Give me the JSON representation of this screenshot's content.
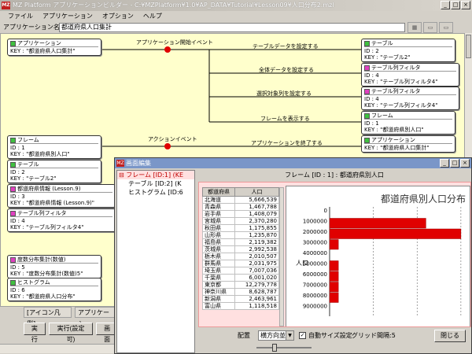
{
  "window": {
    "title": "MZ Platform アプリケーションビルダー - C:¥MZPlatform¥1.0¥AP_DATA¥Tutorial¥Lesson09¥人口分布2.mzl",
    "icon": "MZ",
    "min": "_",
    "max": "□",
    "close": "×"
  },
  "menu": [
    "ファイル",
    "アプリケーション",
    "オプション",
    "ヘルプ"
  ],
  "app_name": {
    "label": "アプリケーション名称",
    "value": "都道府県人口集計"
  },
  "canvas": {
    "events": {
      "app_start": "アプリケーション開始イベント",
      "action": "アクションイベント"
    },
    "conn_labels": [
      "テーブルデータを設定する",
      "全体データを設定する",
      "選択対象列を設定する",
      "フレームを表示する",
      "アプリケーションを終了する"
    ],
    "left_nodes": [
      {
        "title": "アプリケーション",
        "l1": "",
        "l2": "KEY : \"都道府県人口集計\"",
        "color": "green"
      },
      {
        "title": "フレーム",
        "l1": "ID : 1",
        "l2": "KEY : \"都道府県別人口\"",
        "color": "green"
      },
      {
        "title": "テーブル",
        "l1": "ID : 2",
        "l2": "KEY : \"テーブル2\"",
        "color": "green"
      },
      {
        "title": "都道府県情報 (Lesson.9)",
        "l1": "ID : 3",
        "l2": "KEY : \"都道府県情報 (Lesson.9)\"",
        "color": "pink"
      },
      {
        "title": "テーブル列フィルタ",
        "l1": "ID : 4",
        "l2": "KEY : \"テーブル列フィルタ4\"",
        "color": "pink"
      },
      {
        "title": "度数分布集計(数値)",
        "l1": "ID : 5",
        "l2": "KEY : \"度数分布集計(数値)5\"",
        "color": "pink"
      },
      {
        "title": "ヒストグラム",
        "l1": "ID : 6",
        "l2": "KEY : \"都道府県人口分布\"",
        "color": "green"
      }
    ],
    "right_nodes": [
      {
        "title": "テーブル",
        "l1": "ID : 2",
        "l2": "KEY : \"テーブル2\"",
        "color": "green"
      },
      {
        "title": "テーブル列フィルタ",
        "l1": "ID : 4",
        "l2": "KEY : \"テーブル列フィルタ4\"",
        "color": "pink"
      },
      {
        "title": "テーブル列フィルタ",
        "l1": "ID : 4",
        "l2": "KEY : \"テーブル列フィルタ4\"",
        "color": "pink"
      },
      {
        "title": "フレーム",
        "l1": "ID : 1",
        "l2": "KEY : \"都道府県別人口\"",
        "color": "green"
      },
      {
        "title": "アプリケーション",
        "l1": "",
        "l2": "KEY : \"都道府県人口集計\"",
        "color": "green"
      }
    ]
  },
  "bottom_tabs": [
    "[アイコン凡例]",
    "アプリケーシ"
  ],
  "bottom_buttons": [
    "実行",
    "実行(設定可)",
    "画面"
  ],
  "edit_window": {
    "title": "画面編集",
    "tree": {
      "root": "フレーム [ID:1] (KE",
      "children": [
        "テーブル [ID:2] (K",
        "ヒストグラム [ID:6"
      ]
    },
    "pane_title": "フレーム [ID : 1] : 都道府県別人口",
    "table": {
      "headers": [
        "都道府県",
        "人口"
      ],
      "rows": [
        [
          "北海道",
          "5,666,539"
        ],
        [
          "青森県",
          "1,467,788"
        ],
        [
          "岩手県",
          "1,408,079"
        ],
        [
          "宮城県",
          "2,370,280"
        ],
        [
          "秋田県",
          "1,175,855"
        ],
        [
          "山形県",
          "1,235,870"
        ],
        [
          "福島県",
          "2,119,382"
        ],
        [
          "茨城県",
          "2,992,538"
        ],
        [
          "栃木県",
          "2,010,507"
        ],
        [
          "群馬県",
          "2,031,975"
        ],
        [
          "埼玉県",
          "7,007,036"
        ],
        [
          "千葉県",
          "6,001,020"
        ],
        [
          "東京都",
          "12,279,778"
        ],
        [
          "神奈川県",
          "8,628,787"
        ],
        [
          "新潟県",
          "2,463,961"
        ],
        [
          "富山県",
          "1,118,518"
        ]
      ]
    },
    "layout_label": "配置",
    "layout_value": "横方向並列",
    "autosize_check": "✓",
    "autosize_label": "自動サイズ設定",
    "grid_label": "グリッド間隔:5",
    "close_button": "閉じる"
  },
  "chart_data": {
    "type": "bar",
    "title": "都道府県別人口分布",
    "ylabel": "人口",
    "categories": [
      0,
      1000000,
      2000000,
      3000000,
      4000000,
      5000000,
      6000000,
      7000000,
      8000000,
      9000000
    ],
    "values": [
      0,
      11,
      15,
      1,
      0,
      1,
      1,
      1,
      1,
      0
    ],
    "xlim": [
      0,
      16
    ]
  }
}
